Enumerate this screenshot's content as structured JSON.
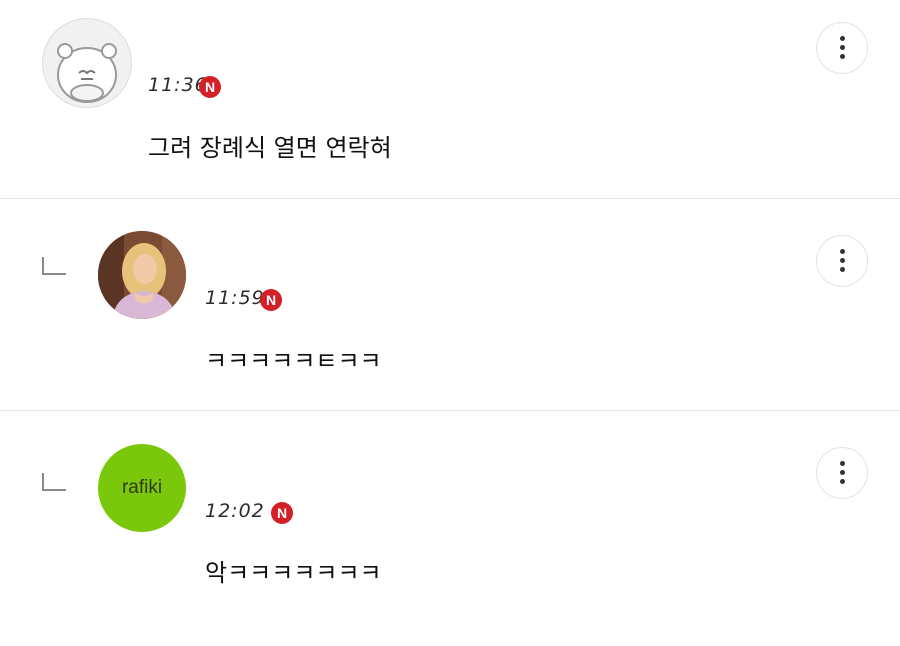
{
  "comments": [
    {
      "time": "11:36",
      "badge": "N",
      "text": "그려 장례식 열면 연락혀",
      "avatar": "hamster-avatar-icon",
      "is_reply": false
    },
    {
      "time": "11:59",
      "badge": "N",
      "text": "ㅋㅋㅋㅋㅋㅌㅋㅋ",
      "avatar": "photo-avatar",
      "is_reply": true
    },
    {
      "time": "12:02",
      "badge": "N",
      "text": "악ㅋㅋㅋㅋㅋㅋㅋ",
      "avatar_label": "rafiki",
      "is_reply": true
    }
  ],
  "colors": {
    "badge": "#d31f26",
    "rafiki_avatar": "#7ac70c",
    "divider": "#e6e6e6"
  }
}
